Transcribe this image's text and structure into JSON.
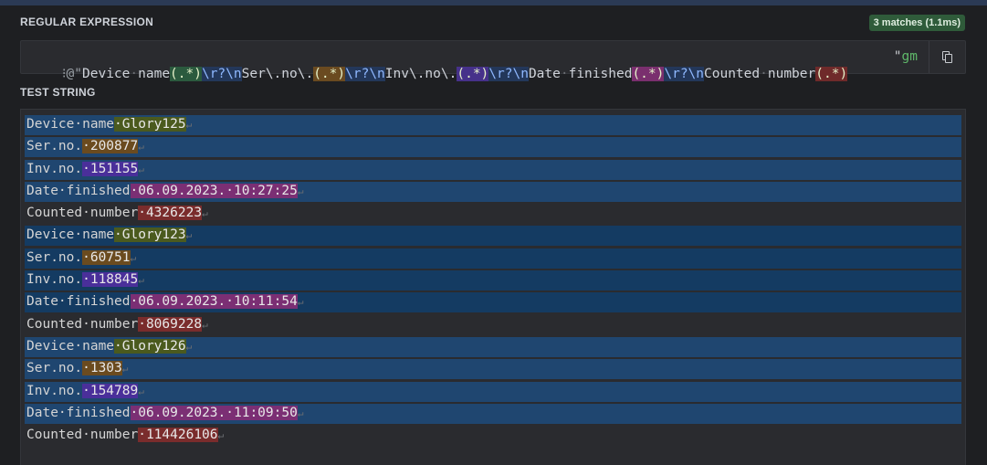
{
  "regex_panel": {
    "title": "REGULAR EXPRESSION",
    "match_badge": "3 matches (1.1ms)",
    "delimiter_open": "@\"",
    "delimiter_close": "\"",
    "flags": "gm",
    "tokens": [
      {
        "t": "Device",
        "c": ""
      },
      {
        "t": "·",
        "c": "sp"
      },
      {
        "t": "name",
        "c": ""
      },
      {
        "t": "(.*)",
        "c": "g1"
      },
      {
        "t": "\\r?\\n",
        "c": "esc"
      },
      {
        "t": "Ser\\.no\\.",
        "c": ""
      },
      {
        "t": "(.*)",
        "c": "g2"
      },
      {
        "t": "\\r?\\n",
        "c": "esc"
      },
      {
        "t": "Inv\\.no\\.",
        "c": ""
      },
      {
        "t": "(.*)",
        "c": "g3"
      },
      {
        "t": "\\r?\\n",
        "c": "esc"
      },
      {
        "t": "Date",
        "c": ""
      },
      {
        "t": "·",
        "c": "sp"
      },
      {
        "t": "finished",
        "c": ""
      },
      {
        "t": "(.*)",
        "c": "g4"
      },
      {
        "t": "\\r?\\n",
        "c": "esc"
      },
      {
        "t": "Counted",
        "c": ""
      },
      {
        "t": "·",
        "c": "sp"
      },
      {
        "t": "number",
        "c": ""
      },
      {
        "t": "(.*)",
        "c": "g5"
      }
    ]
  },
  "test_panel": {
    "title": "TEST STRING",
    "lines": [
      {
        "match": 1,
        "label": "Device·name",
        "value": "·Glory125",
        "vc": "v1"
      },
      {
        "match": 1,
        "label": "Ser.no.",
        "value": "·200877",
        "vc": "v2"
      },
      {
        "match": 1,
        "label": "Inv.no.",
        "value": "·151155",
        "vc": "v3"
      },
      {
        "match": 1,
        "label": "Date·finished",
        "value": "·06.09.2023.·10:27:25",
        "vc": "v4"
      },
      {
        "match": 0,
        "label": "Counted·number",
        "value": "·4326223",
        "vc": "v5"
      },
      {
        "match": 2,
        "label": "Device·name",
        "value": "·Glory123",
        "vc": "v1"
      },
      {
        "match": 2,
        "label": "Ser.no.",
        "value": "·60751",
        "vc": "v2"
      },
      {
        "match": 2,
        "label": "Inv.no.",
        "value": "·118845",
        "vc": "v3"
      },
      {
        "match": 2,
        "label": "Date·finished",
        "value": "·06.09.2023.·10:11:54",
        "vc": "v4"
      },
      {
        "match": 0,
        "label": "Counted·number",
        "value": "·8069228",
        "vc": "v5"
      },
      {
        "match": 3,
        "label": "Device·name",
        "value": "·Glory126",
        "vc": "v1"
      },
      {
        "match": 3,
        "label": "Ser.no.",
        "value": "·1303",
        "vc": "v2"
      },
      {
        "match": 3,
        "label": "Inv.no.",
        "value": "·154789",
        "vc": "v3"
      },
      {
        "match": 3,
        "label": "Date·finished",
        "value": "·06.09.2023.·11:09:50",
        "vc": "v4"
      },
      {
        "match": 0,
        "label": "Counted·number",
        "value": "·114426106",
        "vc": "v5"
      }
    ],
    "newline_glyph": "↵"
  },
  "icons": {
    "copy": "copy-icon",
    "drag": "drag-handle-icon"
  }
}
